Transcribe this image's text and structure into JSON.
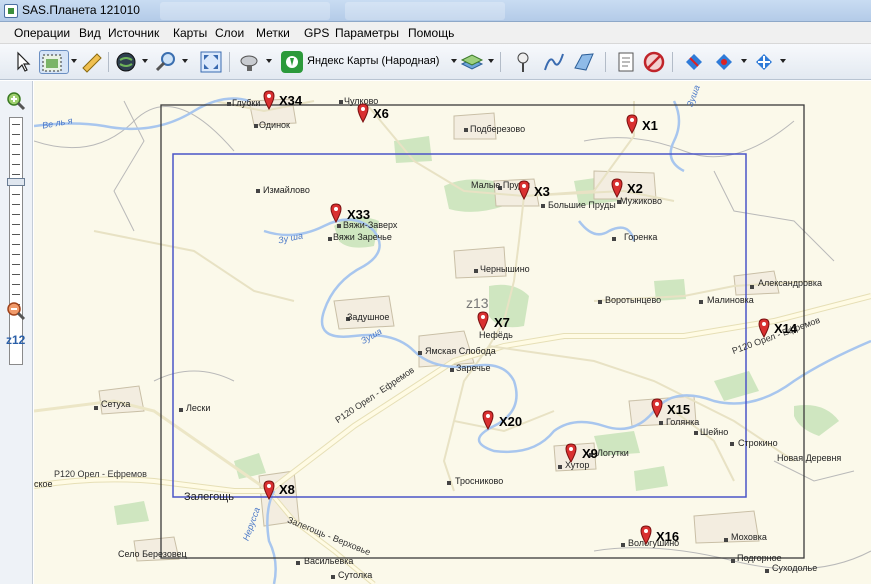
{
  "window": {
    "title": "SAS.Планета 121010"
  },
  "menu": [
    "Операции",
    "Вид",
    "Источник",
    "Карты",
    "Слои",
    "Метки",
    "GPS",
    "Параметры",
    "Помощь"
  ],
  "toolbar": {
    "map_source": "Яндекс Карты (Народная)"
  },
  "zoom": {
    "level_label": "z12",
    "slider_level": 0.25
  },
  "map": {
    "zoom_overlay": "z13",
    "city": "Залегощь",
    "rivers": [
      "Ве ль я",
      "Зуша",
      "Зу ша",
      "Зуша",
      "Нерусса"
    ],
    "roads": [
      "P120 Орел - Ефремов",
      "P120 Орел - Ефремов",
      "P120 Орел - Ефремов",
      "Залегощь - Верховье"
    ],
    "places": [
      "Глубки",
      "Чулково",
      "Одинок",
      "Подберезово",
      "Измайлово",
      "Малые Пруды",
      "Большие Пруды",
      "Мужиково",
      "Вяжи-Заверх",
      "Вяжи Заречье",
      "Горенка",
      "Чернышино",
      "Александровка",
      "Воротынцево",
      "Малиновка",
      "Задушное",
      "Нефёдь",
      "Ямская Слобода",
      "Заречье",
      "Сетуха",
      "Лески",
      "Голянка",
      "Шейно",
      "Строкино",
      "Новая Деревня",
      "Хутор",
      "Логутки",
      "Тросниково",
      "Моховка",
      "Вологушино",
      "Село Березовец",
      "Васильевка",
      "Сутолка",
      "Суходолье",
      "Подгорное",
      "ское"
    ],
    "markers": [
      "X34",
      "X6",
      "X1",
      "X3",
      "X2",
      "X33",
      "X7",
      "X14",
      "X15",
      "X20",
      "X9",
      "X8",
      "X16"
    ]
  }
}
